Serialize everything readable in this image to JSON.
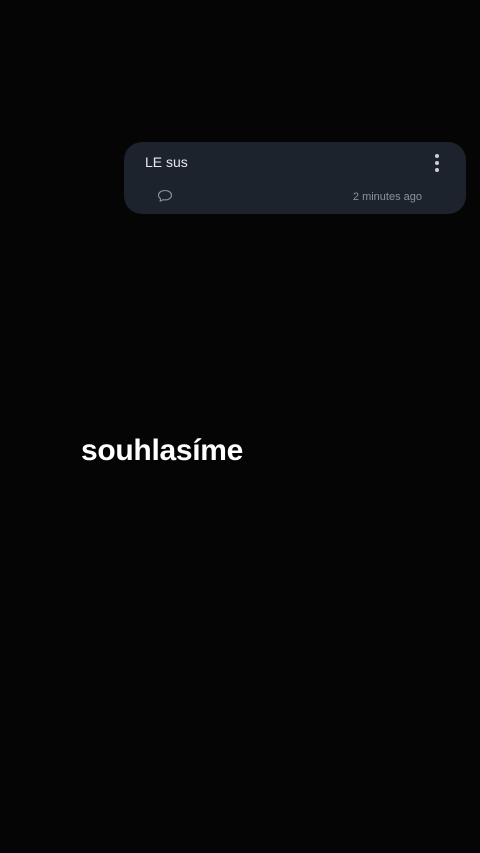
{
  "comment": {
    "text": "LE sus",
    "timestamp": "2 minutes ago",
    "reply_icon": "speech-bubble-icon",
    "more_icon": "vertical-dots-icon"
  },
  "caption": {
    "text": "souhlasíme"
  },
  "colors": {
    "background": "#050505",
    "card": "#1c232c",
    "text": "#e6e9ee",
    "muted": "#8c939c"
  }
}
